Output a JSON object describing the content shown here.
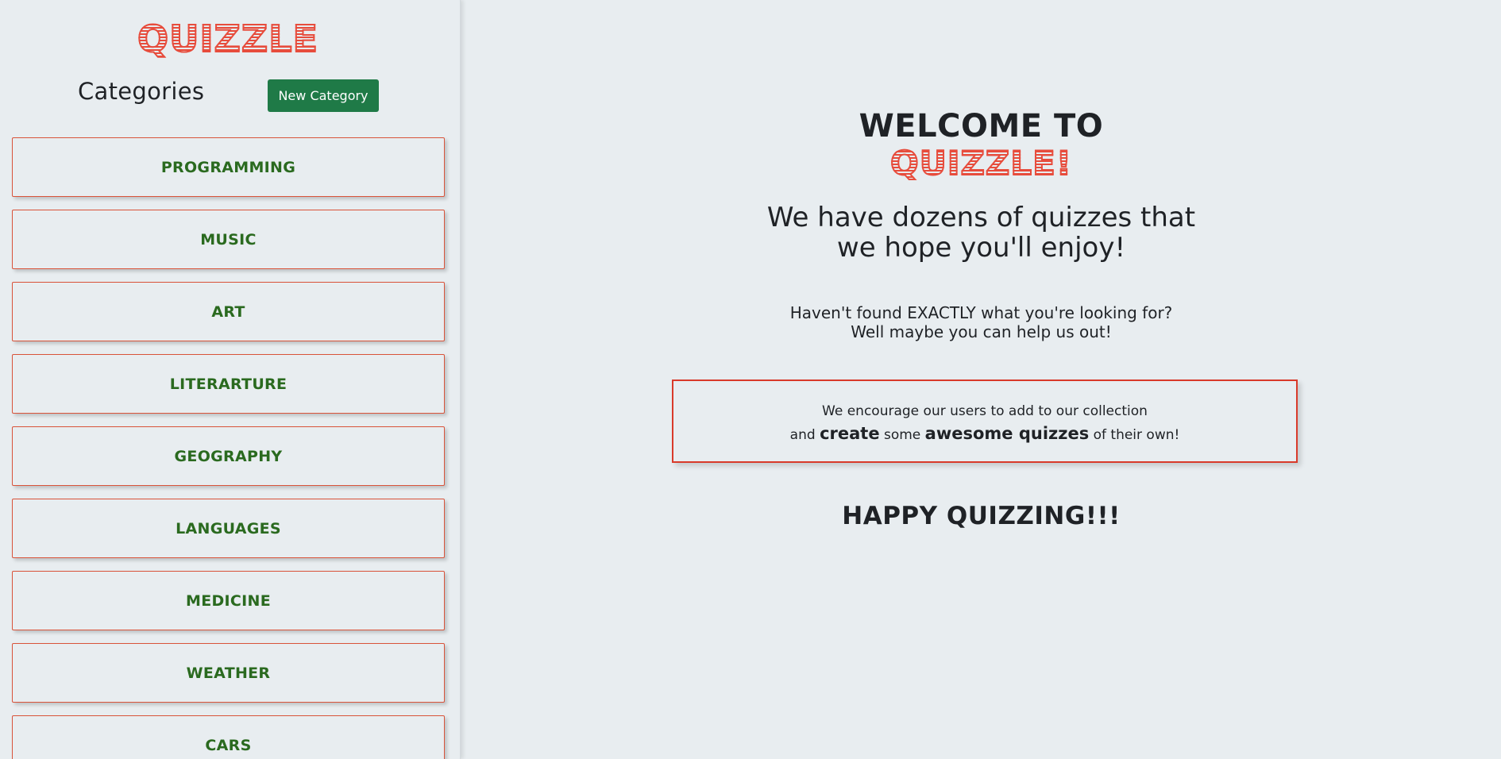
{
  "brand": {
    "logo_text": "QUIZZLE",
    "accent_color": "#e74c3c",
    "primary_color": "#1f7a47"
  },
  "sidebar": {
    "title": "Categories",
    "new_category_label": "New Category",
    "categories": [
      "PROGRAMMING",
      "MUSIC",
      "ART",
      "LITERARTURE",
      "GEOGRAPHY",
      "LANGUAGES",
      "MEDICINE",
      "WEATHER",
      "CARS"
    ]
  },
  "main": {
    "welcome_line": "WELCOME TO",
    "welcome_logo": "QUIZZLE!",
    "lead_line1": "We have dozens of quizzes that",
    "lead_line2": "we hope you'll enjoy!",
    "sub_line1": "Haven't found EXACTLY what you're looking for?",
    "sub_line2": "Well maybe you can help us out!",
    "callout": {
      "line1": "We encourage our users to add to our collection",
      "and": "and",
      "create": "create",
      "some": "some",
      "awesome": "awesome quizzes",
      "tail": "of their own!"
    },
    "closing": "HAPPY QUIZZING!!!"
  }
}
